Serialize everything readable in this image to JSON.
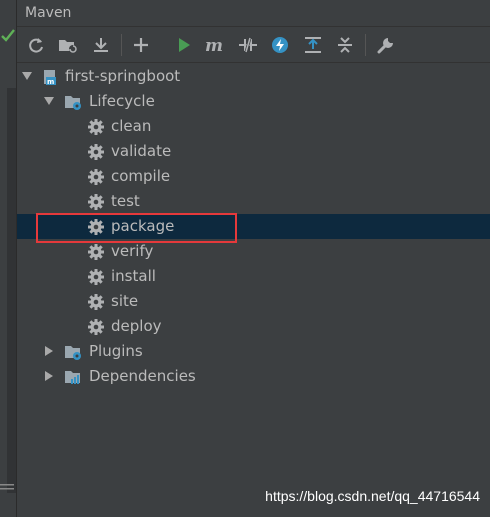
{
  "header": {
    "title": "Maven"
  },
  "toolbar": {
    "buttons": [
      {
        "icon": "reimport-icon"
      },
      {
        "icon": "generate-sources-icon"
      },
      {
        "icon": "download-icon"
      },
      {
        "icon": "add-icon"
      },
      {
        "icon": "run-icon"
      },
      {
        "icon": "execute-goal-icon"
      },
      {
        "icon": "toggle-offline-icon"
      },
      {
        "icon": "skip-tests-icon"
      },
      {
        "icon": "show-dependencies-icon"
      },
      {
        "icon": "collapse-all-icon"
      },
      {
        "icon": "settings-wrench-icon"
      }
    ]
  },
  "tree": {
    "project": {
      "label": "first-springboot"
    },
    "lifecycle": {
      "label": "Lifecycle",
      "goals": [
        "clean",
        "validate",
        "compile",
        "test",
        "package",
        "verify",
        "install",
        "site",
        "deploy"
      ],
      "selected": "package"
    },
    "plugins": {
      "label": "Plugins"
    },
    "dependencies": {
      "label": "Dependencies"
    }
  },
  "watermark": "https://blog.csdn.net/qq_44716544",
  "colors": {
    "background": "#3c3f41",
    "selection": "#0d293e",
    "highlight": "#e5393b",
    "run_green": "#499c54",
    "accent_blue": "#3592c4"
  }
}
